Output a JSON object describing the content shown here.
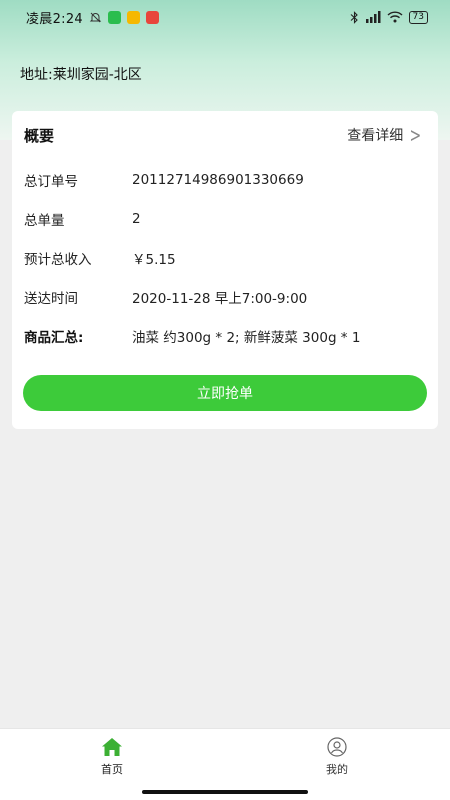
{
  "status_bar": {
    "time": "凌晨2:24",
    "battery": "73"
  },
  "header": {
    "address": "地址:莱圳家园-北区"
  },
  "summary": {
    "title": "概要",
    "detail_link": "查看详细",
    "rows": [
      {
        "label": "总订单号",
        "value": "20112714986901330669"
      },
      {
        "label": "总单量",
        "value": "2"
      },
      {
        "label": "预计总收入",
        "value": "￥5.15"
      },
      {
        "label": "送达时间",
        "value": "2020-11-28 早上7:00-9:00"
      },
      {
        "label": "商品汇总:",
        "value": "油菜 约300g * 2; 新鲜菠菜 300g * 1"
      }
    ],
    "action_label": "立即抢单"
  },
  "tabbar": {
    "home_label": "首页",
    "mine_label": "我的"
  },
  "colors": {
    "accent": "#3dcb3a",
    "header_gradient_top": "#9fdcc3"
  },
  "icons": {
    "home": "home-icon",
    "mine": "user-circle-icon",
    "detail": "chevron-right-icon"
  }
}
